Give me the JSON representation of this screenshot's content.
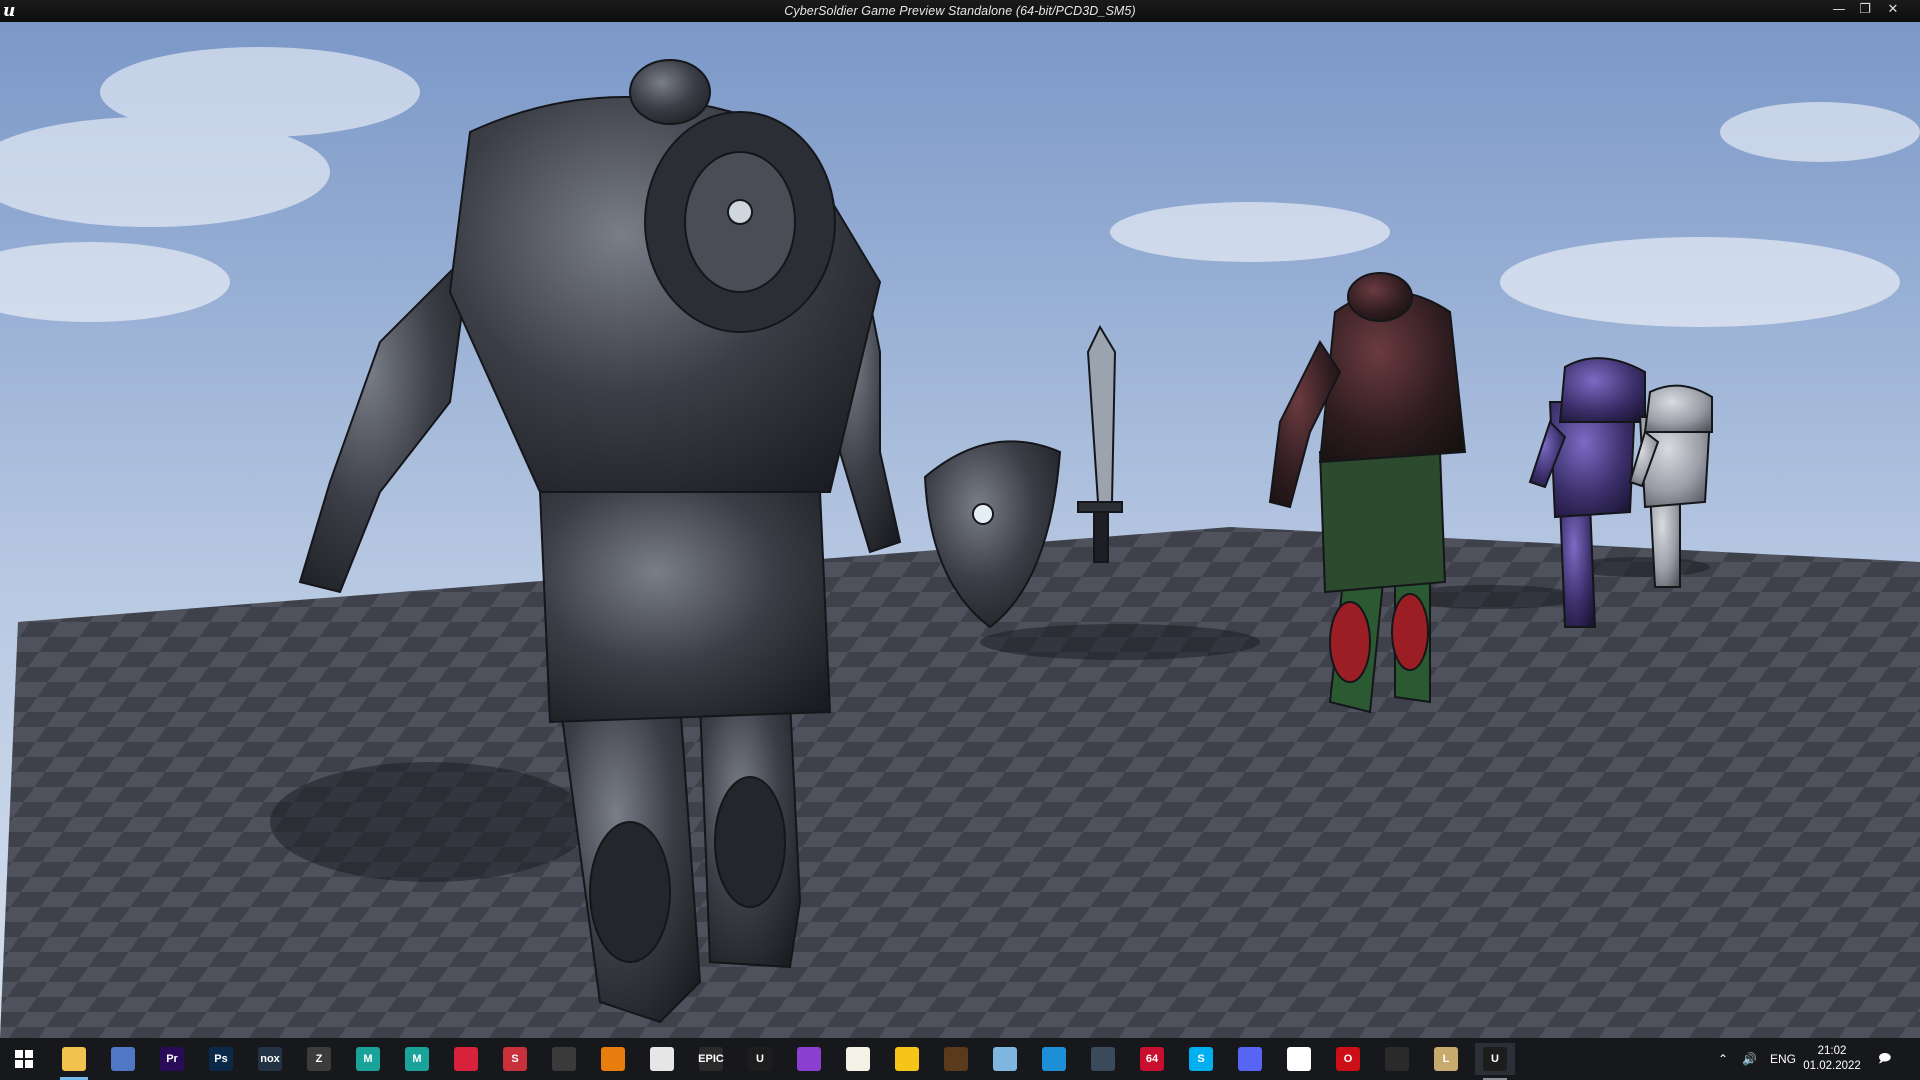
{
  "window": {
    "app_icon": "unreal-engine-logo",
    "title": "CyberSoldier Game Preview Standalone (64-bit/PCD3D_SM5)",
    "controls": {
      "minimize": "minimize-icon",
      "maximize": "restore-icon",
      "close": "close-icon"
    }
  },
  "scene": {
    "description_icons": [
      "armored-soldier-back-view",
      "shield",
      "sword",
      "red-green-soldier",
      "purple-soldier",
      "silver-soldier"
    ],
    "colors": {
      "sky_top": "#7f9ccc",
      "sky_bottom": "#c9d6ea",
      "floor_dark": "#3a3d47",
      "floor_light": "#5a5d68"
    }
  },
  "taskbar": {
    "start_icon": "windows-start-icon",
    "apps": [
      {
        "id": "file-explorer",
        "label": "",
        "color": "#f2c14e"
      },
      {
        "id": "calculator",
        "label": "",
        "color": "#4f77c4"
      },
      {
        "id": "premiere",
        "label": "Pr",
        "color": "#2a0b59"
      },
      {
        "id": "photoshop",
        "label": "Ps",
        "color": "#0b2a4a"
      },
      {
        "id": "nox",
        "label": "nox",
        "color": "#233245"
      },
      {
        "id": "zbrush",
        "label": "Z",
        "color": "#3c3c3c"
      },
      {
        "id": "maya-1",
        "label": "M",
        "color": "#1aa39a"
      },
      {
        "id": "maya-2",
        "label": "M",
        "color": "#1aa39a"
      },
      {
        "id": "red-app",
        "label": "",
        "color": "#d8213a"
      },
      {
        "id": "substance",
        "label": "S",
        "color": "#c8303a"
      },
      {
        "id": "search-app",
        "label": "",
        "color": "#3a3a3a"
      },
      {
        "id": "blender",
        "label": "",
        "color": "#e87d0d"
      },
      {
        "id": "vs-app",
        "label": "",
        "color": "#e6e6e6"
      },
      {
        "id": "epic-games",
        "label": "EPIC",
        "color": "#2a2a2a"
      },
      {
        "id": "unreal-engine",
        "label": "U",
        "color": "#1d1d1d"
      },
      {
        "id": "swirl-app",
        "label": "",
        "color": "#8b3fd1"
      },
      {
        "id": "music-app",
        "label": "",
        "color": "#f4f1e6"
      },
      {
        "id": "emoji-app",
        "label": "",
        "color": "#f5c518"
      },
      {
        "id": "hat-app",
        "label": "",
        "color": "#5a3a1a"
      },
      {
        "id": "bottle-app",
        "label": "",
        "color": "#7fb7e0"
      },
      {
        "id": "timer-app",
        "label": "",
        "color": "#1c8fd6"
      },
      {
        "id": "game-app",
        "label": "",
        "color": "#3a4a5a"
      },
      {
        "id": "64-app",
        "label": "64",
        "color": "#c8102e"
      },
      {
        "id": "skype",
        "label": "S",
        "color": "#00aff0"
      },
      {
        "id": "discord",
        "label": "",
        "color": "#5865f2"
      },
      {
        "id": "yandex-app",
        "label": "",
        "color": "#ffffff"
      },
      {
        "id": "opera",
        "label": "O",
        "color": "#cc0f16"
      },
      {
        "id": "steam-like",
        "label": "",
        "color": "#2a2a2a"
      },
      {
        "id": "league",
        "label": "L",
        "color": "#c8aa6e"
      },
      {
        "id": "unreal-engine-running",
        "label": "U",
        "color": "#1d1d1d"
      }
    ],
    "tray": {
      "chevron": "chevron-up-icon",
      "volume": "speaker-icon",
      "language": "ENG",
      "time": "21:02",
      "date": "01.02.2022",
      "notifications": "notification-icon"
    }
  }
}
